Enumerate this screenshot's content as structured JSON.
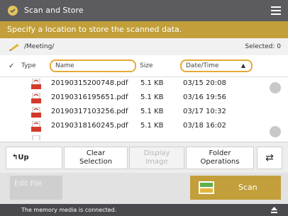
{
  "window": {
    "title": "Scan and Store"
  },
  "instruction": "Specify a location to store the scanned data.",
  "location": {
    "path": "/Meeting/",
    "selected": "Selected: 0"
  },
  "table": {
    "columns": {
      "type": "Type",
      "name": "Name",
      "size": "Size",
      "date": "Date/Time"
    },
    "sort": "ascending",
    "rows": [
      {
        "name": "20190315200748.pdf",
        "size": "5.1 KB",
        "date": "03/15  20:08"
      },
      {
        "name": "20190316195651.pdf",
        "size": "5.1 KB",
        "date": "03/16  19:56"
      },
      {
        "name": "20190317103256.pdf",
        "size": "5.1 KB",
        "date": "03/17  10:32"
      },
      {
        "name": "20190318160245.pdf",
        "size": "5.1 KB",
        "date": "03/18  16:02"
      }
    ]
  },
  "toolbar": {
    "up": "Up",
    "clear_1": "Clear",
    "clear_2": "Selection",
    "display_1": "Display",
    "display_2": "Image",
    "folder_1": "Folder",
    "folder_2": "Operations"
  },
  "actions": {
    "edit_file": "Edit File",
    "scan": "Scan"
  },
  "status": {
    "message": "The memory media is connected."
  },
  "colors": {
    "accent": "#c29f3a",
    "highlight": "#e5a93a",
    "titlebar": "#5c5c60",
    "pdf_red": "#d33a2c"
  },
  "icons": [
    "scan-store-icon",
    "menu-icon",
    "pencil-icon",
    "pdf-file-icon",
    "scroll-up-icon",
    "scroll-down-icon",
    "up-arrow-icon",
    "refresh-icon",
    "scan-icon",
    "eject-icon"
  ]
}
